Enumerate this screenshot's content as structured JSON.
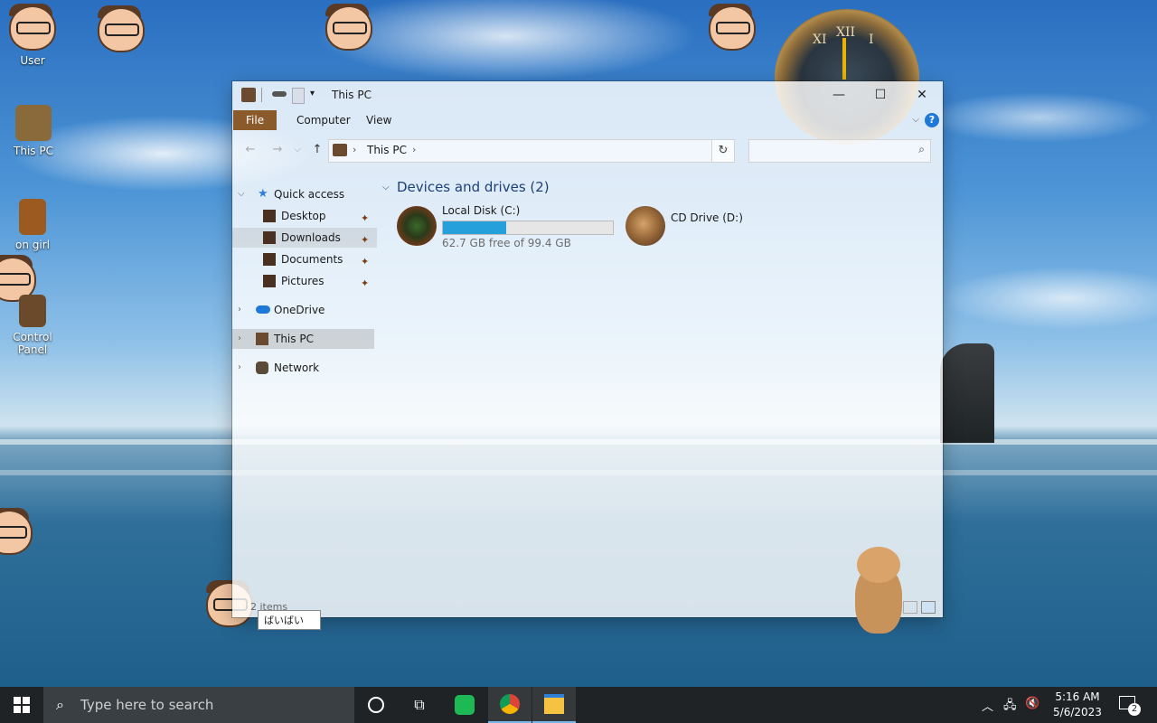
{
  "desktop": {
    "icons": [
      {
        "label": "User"
      },
      {
        "label": "This PC"
      },
      {
        "label": "on girl"
      },
      {
        "label": "Control Panel"
      }
    ],
    "tooltip": "ばいばい",
    "clock_numerals": [
      "XII",
      "XI",
      "I"
    ]
  },
  "window": {
    "title": "This PC",
    "controls": {
      "minimize": "—",
      "maximize": "☐",
      "close": "✕"
    },
    "ribbon_tabs": [
      "File",
      "Computer",
      "View"
    ],
    "help": "?",
    "address": {
      "crumb": "This PC",
      "sep1": "›",
      "sep2": "›"
    },
    "search_placeholder": "",
    "nav": {
      "quick_access": "Quick access",
      "quick_items": [
        "Desktop",
        "Downloads",
        "Documents",
        "Pictures"
      ],
      "onedrive": "OneDrive",
      "this_pc": "This PC",
      "network": "Network"
    },
    "group_header": "Devices and drives (2)",
    "drives": [
      {
        "name": "Local Disk (C:)",
        "free": "62.7 GB free of 99.4 GB",
        "used_fraction": 0.37
      },
      {
        "name": "CD Drive (D:)"
      }
    ],
    "status": "2 items"
  },
  "taskbar": {
    "search_placeholder": "Type here to search",
    "time": "5:16 AM",
    "date": "5/6/2023",
    "notifications": "2"
  },
  "colors": {
    "file_tab": "#8a5a2b",
    "drive_fill": "#26a0da",
    "accent": "#1e78d7"
  }
}
